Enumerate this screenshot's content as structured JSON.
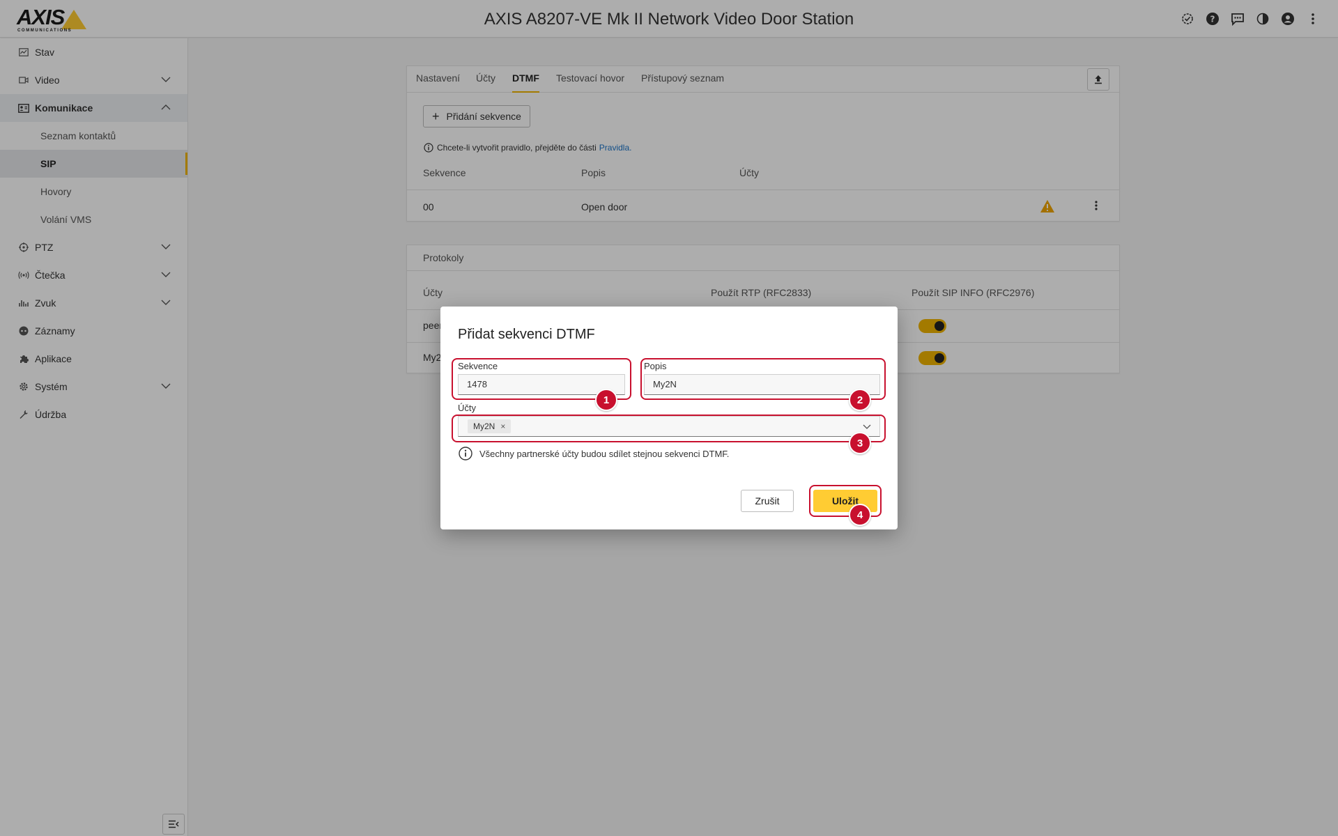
{
  "header": {
    "logo": "AXIS",
    "logo_sub": "COMMUNICATIONS",
    "title": "AXIS A8207-VE Mk II Network Video Door Station",
    "icons": [
      "status-check-icon",
      "help-icon",
      "feedback-icon",
      "contrast-icon",
      "account-icon",
      "more-vert-icon"
    ]
  },
  "sidebar": {
    "items": [
      {
        "label": "Stav",
        "icon": "status-icon"
      },
      {
        "label": "Video",
        "icon": "video-icon"
      },
      {
        "label": "Komunikace",
        "icon": "communication-icon"
      },
      {
        "label": "PTZ",
        "icon": "ptz-icon"
      },
      {
        "label": "Čtečka",
        "icon": "reader-icon"
      },
      {
        "label": "Zvuk",
        "icon": "audio-icon"
      },
      {
        "label": "Záznamy",
        "icon": "recordings-icon"
      },
      {
        "label": "Aplikace",
        "icon": "apps-icon"
      },
      {
        "label": "Systém",
        "icon": "system-icon"
      },
      {
        "label": "Údržba",
        "icon": "maintenance-icon"
      }
    ],
    "sub_items": [
      "Seznam kontaktů",
      "SIP",
      "Hovory",
      "Volání VMS"
    ]
  },
  "tabs": [
    "Nastavení",
    "Účty",
    "DTMF",
    "Testovací hovor",
    "Přístupový seznam"
  ],
  "dtmf": {
    "add_button": "Přidání sekvence",
    "info_text": "Chcete-li vytvořit pravidlo, přejděte do části",
    "info_link": "Pravidla.",
    "columns": [
      "Sekvence",
      "Popis",
      "Účty"
    ],
    "rows": [
      {
        "sequence": "00",
        "description": "Open door"
      }
    ]
  },
  "protocols": {
    "title": "Protokoly",
    "columns": [
      "Účty",
      "Použít RTP (RFC2833)",
      "Použít SIP INFO (RFC2976)"
    ],
    "rows": [
      "peer",
      "My2"
    ]
  },
  "modal": {
    "title": "Přidat sekvenci DTMF",
    "sequence_label": "Sekvence",
    "sequence_value": "1478",
    "description_label": "Popis",
    "description_value": "My2N",
    "accounts_label": "Účty",
    "accounts_chip": "My2N",
    "info": "Všechny partnerské účty budou sdílet stejnou sekvenci DTMF.",
    "cancel": "Zrušit",
    "save": "Uložit",
    "badges": [
      "1",
      "2",
      "3",
      "4"
    ]
  },
  "colors": {
    "accent": "#ffcc33",
    "highlight": "#c8102e",
    "link": "#1a73c8"
  }
}
